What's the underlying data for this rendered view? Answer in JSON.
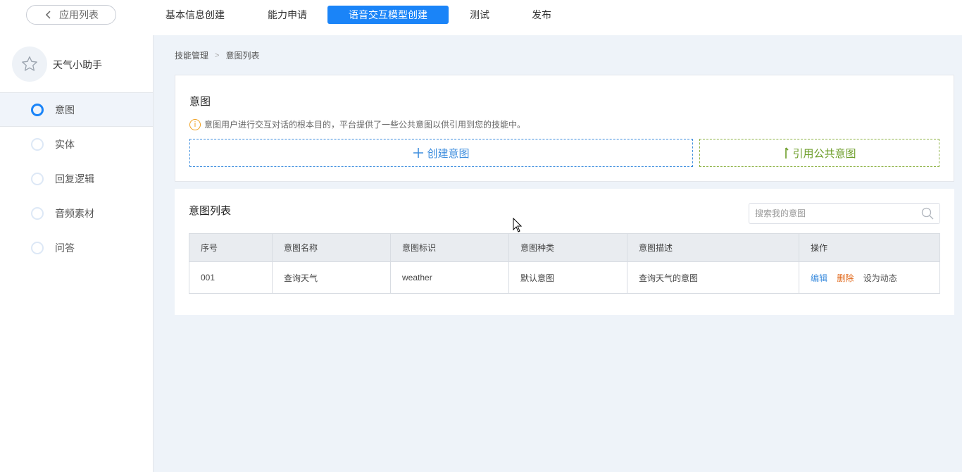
{
  "topbar": {
    "back_label": "应用列表",
    "steps": [
      {
        "label": "基本信息创建",
        "active": false
      },
      {
        "label": "能力申请",
        "active": false
      },
      {
        "label": "语音交互模型创建",
        "active": true
      },
      {
        "label": "测试",
        "active": false
      },
      {
        "label": "发布",
        "active": false
      }
    ]
  },
  "sidebar": {
    "app_name": "天气小助手",
    "items": [
      {
        "label": "意图",
        "active": true
      },
      {
        "label": "实体",
        "active": false
      },
      {
        "label": "回复逻辑",
        "active": false
      },
      {
        "label": "音频素材",
        "active": false
      },
      {
        "label": "问答",
        "active": false
      }
    ]
  },
  "breadcrumb": {
    "parent": "技能管理",
    "separator": ">",
    "current": "意图列表"
  },
  "intent_card": {
    "title": "意图",
    "tip_icon": "i",
    "tip": "意图用户进行交互对话的根本目的，平台提供了一些公共意图以供引用到您的技能中。",
    "create_label": "创建意图",
    "cite_label": "引用公共意图"
  },
  "list_card": {
    "title": "意图列表",
    "search_placeholder": "搜索我的意图",
    "columns": [
      "序号",
      "意图名称",
      "意图标识",
      "意图种类",
      "意图描述",
      "操作"
    ],
    "rows": [
      {
        "index": "001",
        "name": "查询天气",
        "identifier": "weather",
        "kind": "默认意图",
        "description": "查询天气的意图",
        "actions": {
          "edit": "编辑",
          "delete": "删除",
          "dynamic": "设为动态"
        }
      }
    ]
  },
  "colors": {
    "primary": "#1a84f8",
    "create_border": "#3e8ede",
    "cite_border": "#8db244",
    "delete": "#e06414",
    "tip": "#f0a020",
    "background": "#eef3f9"
  }
}
